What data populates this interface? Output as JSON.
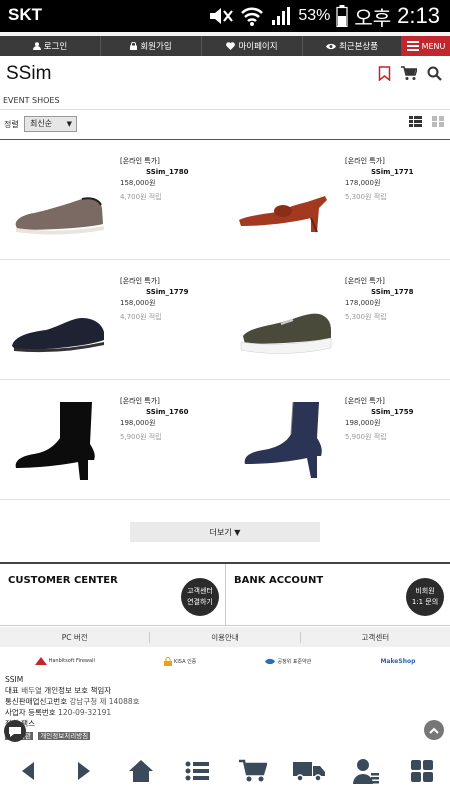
{
  "status_bar": {
    "carrier": "SKT",
    "battery": "53%",
    "ampm": "오후",
    "time": "2:13"
  },
  "top_nav": {
    "items": [
      {
        "label": "로그인",
        "icon": "user-icon"
      },
      {
        "label": "회원가입",
        "icon": "lock-icon"
      },
      {
        "label": "마이페이지",
        "icon": "heart-icon"
      },
      {
        "label": "최근본상품",
        "icon": "eye-icon"
      }
    ],
    "menu_label": "MENU"
  },
  "header": {
    "logo": "SSim"
  },
  "breadcrumb": "EVENT SHOES",
  "sort": {
    "label": "정렬",
    "selected": "최신순"
  },
  "products": [
    {
      "tag": "[온라인 특가]",
      "code": "SSim_1780",
      "price": "158,000원",
      "points": "4,700원 적립",
      "color": "#7a6a63"
    },
    {
      "tag": "[온라인 특가]",
      "code": "SSim_1771",
      "price": "178,000원",
      "points": "5,300원 적립",
      "color": "#a33a1f"
    },
    {
      "tag": "[온라인 특가]",
      "code": "SSim_1779",
      "price": "158,000원",
      "points": "4,700원 적립",
      "color": "#1e2233"
    },
    {
      "tag": "[온라인 특가]",
      "code": "SSim_1778",
      "price": "178,000원",
      "points": "5,300원 적립",
      "color": "#4a4a3a"
    },
    {
      "tag": "[온라인 특가]",
      "code": "SSim_1760",
      "price": "198,000원",
      "points": "5,900원 적립",
      "color": "#0c0c0c"
    },
    {
      "tag": "[온라인 특가]",
      "code": "SSim_1759",
      "price": "198,000원",
      "points": "5,900원 적립",
      "color": "#2c3455"
    }
  ],
  "more_button": "더보기 ▼",
  "customer_center": {
    "title": "CUSTOMER CENTER",
    "button_line1": "고객센터",
    "button_line2": "연결하기"
  },
  "bank_account": {
    "title": "BANK ACCOUNT",
    "button_line1": "비회원",
    "button_line2": "1:1 문의"
  },
  "footer_links": [
    "PC 버전",
    "이용안내",
    "고객센터"
  ],
  "badges": [
    "Hanbitsoft Firewall",
    "KISA 인증",
    "공정위 표준약관",
    "MakeShop"
  ],
  "company": {
    "name": "SSIM",
    "line1_label": "대표",
    "line1_value": "배두열",
    "line1_suffix": "개인정보 보호 책임자",
    "line2_label": "통신판매업신고번호",
    "line2_value": "강남구청 제 14088호",
    "line3_label": "사업자 등록번호",
    "line3_value": "120-09-32191",
    "line4_label": "전화 팩스",
    "tag1": "이용약관",
    "tag2": "개인정보처리방침"
  }
}
